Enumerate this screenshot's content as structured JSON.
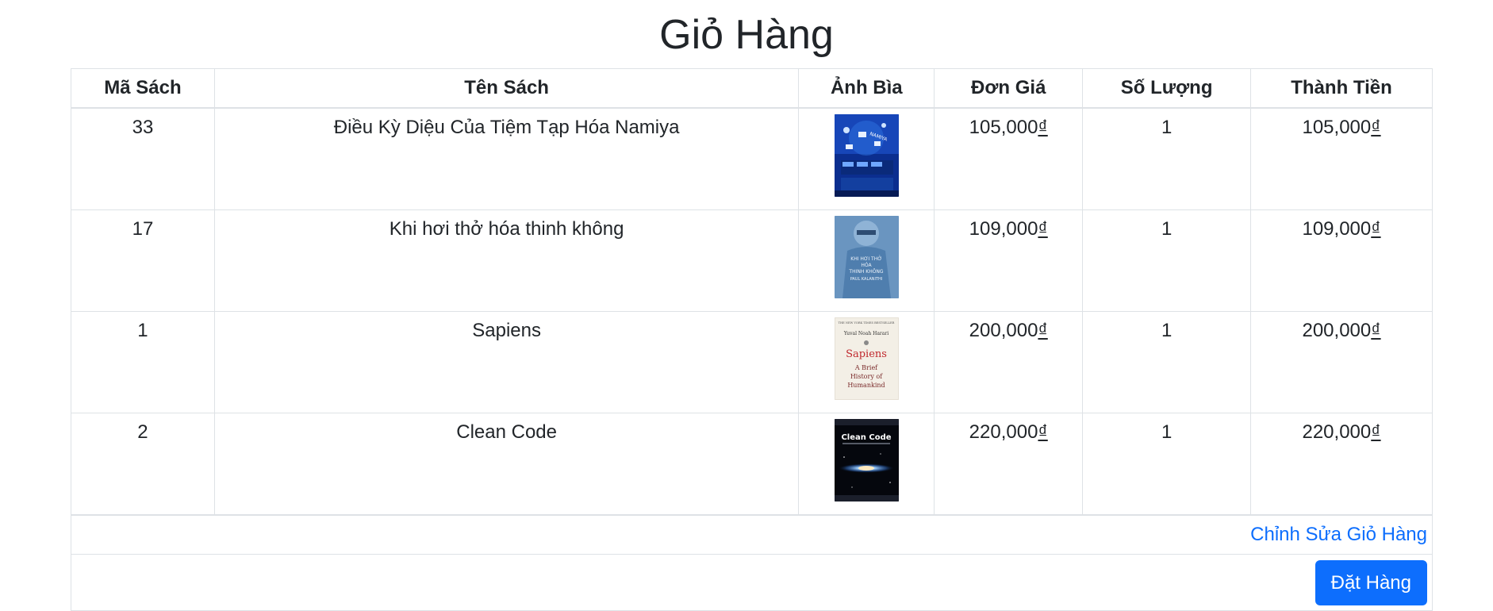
{
  "page": {
    "title": "Giỏ Hàng"
  },
  "table": {
    "headers": [
      "Mã Sách",
      "Tên Sách",
      "Ảnh Bìa",
      "Đơn Giá",
      "Số Lượng",
      "Thành Tiền"
    ],
    "rows": [
      {
        "id": "33",
        "name": "Điều Kỳ Diệu Của Tiệm Tạp Hóa Namiya",
        "cover": "namiya-book-cover",
        "unit_price": "105,000",
        "quantity": "1",
        "total": "105,000"
      },
      {
        "id": "17",
        "name": "Khi hơi thở hóa thinh không",
        "cover": "when-breath-becomes-air-book-cover",
        "unit_price": "109,000",
        "quantity": "1",
        "total": "109,000"
      },
      {
        "id": "1",
        "name": "Sapiens",
        "cover": "sapiens-book-cover",
        "unit_price": "200,000",
        "quantity": "1",
        "total": "200,000"
      },
      {
        "id": "2",
        "name": "Clean Code",
        "cover": "clean-code-book-cover",
        "unit_price": "220,000",
        "quantity": "1",
        "total": "220,000"
      }
    ],
    "currency_symbol": "₫"
  },
  "covers": {
    "namiya": {
      "title_text": "NAMIYA"
    },
    "breath": {
      "line1": "KHI HƠI THỞ",
      "line2": "HÓA",
      "line3": "THINH KHÔNG",
      "author": "PAUL KALANITHI"
    },
    "sapiens": {
      "top": "THE NEW YORK TIMES BESTSELLER",
      "author": "Yuval Noah Harari",
      "title": "Sapiens",
      "sub1": "A Brief",
      "sub2": "History of",
      "sub3": "Humankind"
    },
    "clean_code": {
      "title": "Clean Code"
    }
  },
  "actions": {
    "edit_cart_label": "Chỉnh Sửa Giỏ Hàng",
    "order_label": "Đặt Hàng"
  },
  "colors": {
    "link": "#0d6efd",
    "primary_button": "#0d6efd",
    "border": "#dee2e6"
  }
}
